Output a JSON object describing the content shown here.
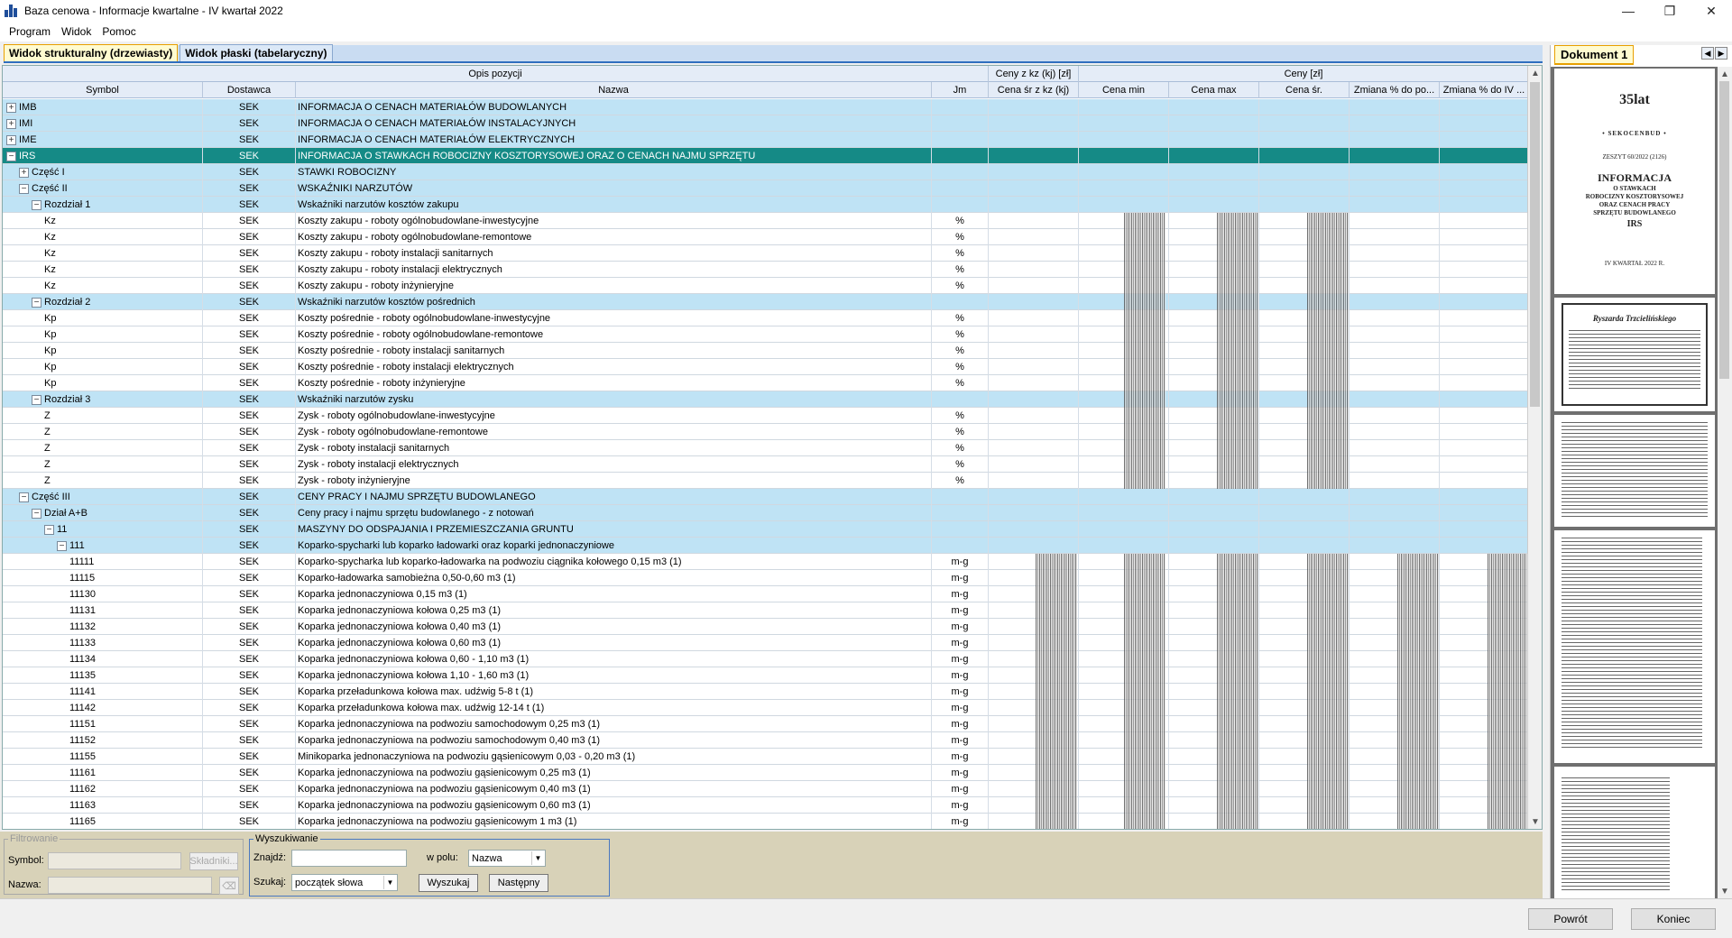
{
  "window": {
    "title": "Baza cenowa - Informacje kwartalne - IV kwartał 2022",
    "minimize": "—",
    "maximize": "❐",
    "close": "✕"
  },
  "menu": [
    "Program",
    "Widok",
    "Pomoc"
  ],
  "tabs": [
    {
      "label": "Widok strukturalny (drzewiasty)"
    },
    {
      "label": "Widok płaski (tabelaryczny)"
    }
  ],
  "grid": {
    "group_headers": {
      "opis": "Opis pozycji",
      "ceny_kz": "Ceny z kz (kj) [zł]",
      "ceny": "Ceny [zł]"
    },
    "columns": [
      "Symbol",
      "Dostawca",
      "Nazwa",
      "Jm",
      "Cena śr z kz (kj)",
      "Cena min",
      "Cena max",
      "Cena śr.",
      "Zmiana % do po...",
      "Zmiana % do IV ..."
    ],
    "rows": [
      {
        "sym": "IMB",
        "dost": "SEK",
        "nazwa": "INFORMACJA O CENACH MATERIAŁÓW BUDOWLANYCH",
        "jm": "",
        "lvl": 0,
        "exp": "+",
        "type": "grp"
      },
      {
        "sym": "IMI",
        "dost": "SEK",
        "nazwa": "INFORMACJA O CENACH MATERIAŁÓW INSTALACYJNYCH",
        "jm": "",
        "lvl": 0,
        "exp": "+",
        "type": "grp"
      },
      {
        "sym": "IME",
        "dost": "SEK",
        "nazwa": "INFORMACJA O CENACH MATERIAŁÓW ELEKTRYCZNYCH",
        "jm": "",
        "lvl": 0,
        "exp": "+",
        "type": "grp"
      },
      {
        "sym": "IRS",
        "dost": "SEK",
        "nazwa": "INFORMACJA O STAWKACH ROBOCIZNY KOSZTORYSOWEJ ORAZ O CENACH NAJMU SPRZĘTU",
        "jm": "",
        "lvl": 0,
        "exp": "−",
        "type": "sel"
      },
      {
        "sym": "Część I",
        "dost": "SEK",
        "nazwa": "STAWKI ROBOCIZNY",
        "jm": "",
        "lvl": 1,
        "exp": "+",
        "type": "grp"
      },
      {
        "sym": "Część II",
        "dost": "SEK",
        "nazwa": "WSKAŹNIKI NARZUTÓW",
        "jm": "",
        "lvl": 1,
        "exp": "−",
        "type": "grp"
      },
      {
        "sym": "Rozdział 1",
        "dost": "SEK",
        "nazwa": "Wskaźniki narzutów kosztów zakupu",
        "jm": "",
        "lvl": 2,
        "exp": "−",
        "type": "grp"
      },
      {
        "sym": "Kz",
        "dost": "SEK",
        "nazwa": "Koszty zakupu - roboty ogólnobudowlane-inwestycyjne",
        "jm": "%",
        "lvl": 3,
        "exp": "",
        "type": "leaf"
      },
      {
        "sym": "Kz",
        "dost": "SEK",
        "nazwa": "Koszty zakupu - roboty ogólnobudowlane-remontowe",
        "jm": "%",
        "lvl": 3,
        "exp": "",
        "type": "leaf"
      },
      {
        "sym": "Kz",
        "dost": "SEK",
        "nazwa": "Koszty zakupu - roboty instalacji sanitarnych",
        "jm": "%",
        "lvl": 3,
        "exp": "",
        "type": "leaf"
      },
      {
        "sym": "Kz",
        "dost": "SEK",
        "nazwa": "Koszty zakupu - roboty instalacji elektrycznych",
        "jm": "%",
        "lvl": 3,
        "exp": "",
        "type": "leaf"
      },
      {
        "sym": "Kz",
        "dost": "SEK",
        "nazwa": "Koszty zakupu - roboty inżynieryjne",
        "jm": "%",
        "lvl": 3,
        "exp": "",
        "type": "leaf"
      },
      {
        "sym": "Rozdział 2",
        "dost": "SEK",
        "nazwa": "Wskaźniki narzutów kosztów pośrednich",
        "jm": "",
        "lvl": 2,
        "exp": "−",
        "type": "grp"
      },
      {
        "sym": "Kp",
        "dost": "SEK",
        "nazwa": "Koszty pośrednie - roboty ogólnobudowlane-inwestycyjne",
        "jm": "%",
        "lvl": 3,
        "exp": "",
        "type": "leaf"
      },
      {
        "sym": "Kp",
        "dost": "SEK",
        "nazwa": "Koszty pośrednie - roboty ogólnobudowlane-remontowe",
        "jm": "%",
        "lvl": 3,
        "exp": "",
        "type": "leaf"
      },
      {
        "sym": "Kp",
        "dost": "SEK",
        "nazwa": "Koszty pośrednie - roboty instalacji sanitarnych",
        "jm": "%",
        "lvl": 3,
        "exp": "",
        "type": "leaf"
      },
      {
        "sym": "Kp",
        "dost": "SEK",
        "nazwa": "Koszty pośrednie - roboty instalacji elektrycznych",
        "jm": "%",
        "lvl": 3,
        "exp": "",
        "type": "leaf"
      },
      {
        "sym": "Kp",
        "dost": "SEK",
        "nazwa": "Koszty pośrednie - roboty inżynieryjne",
        "jm": "%",
        "lvl": 3,
        "exp": "",
        "type": "leaf"
      },
      {
        "sym": "Rozdział 3",
        "dost": "SEK",
        "nazwa": "Wskaźniki narzutów zysku",
        "jm": "",
        "lvl": 2,
        "exp": "−",
        "type": "grp"
      },
      {
        "sym": "Z",
        "dost": "SEK",
        "nazwa": "Zysk - roboty ogólnobudowlane-inwestycyjne",
        "jm": "%",
        "lvl": 3,
        "exp": "",
        "type": "leaf"
      },
      {
        "sym": "Z",
        "dost": "SEK",
        "nazwa": "Zysk - roboty ogólnobudowlane-remontowe",
        "jm": "%",
        "lvl": 3,
        "exp": "",
        "type": "leaf"
      },
      {
        "sym": "Z",
        "dost": "SEK",
        "nazwa": "Zysk - roboty instalacji sanitarnych",
        "jm": "%",
        "lvl": 3,
        "exp": "",
        "type": "leaf"
      },
      {
        "sym": "Z",
        "dost": "SEK",
        "nazwa": "Zysk - roboty instalacji elektrycznych",
        "jm": "%",
        "lvl": 3,
        "exp": "",
        "type": "leaf"
      },
      {
        "sym": "Z",
        "dost": "SEK",
        "nazwa": "Zysk - roboty inżynieryjne",
        "jm": "%",
        "lvl": 3,
        "exp": "",
        "type": "leaf"
      },
      {
        "sym": "Część III",
        "dost": "SEK",
        "nazwa": "CENY PRACY I NAJMU SPRZĘTU BUDOWLANEGO",
        "jm": "",
        "lvl": 1,
        "exp": "−",
        "type": "grp"
      },
      {
        "sym": "Dział A+B",
        "dost": "SEK",
        "nazwa": "Ceny pracy i najmu sprzętu budowlanego - z notowań",
        "jm": "",
        "lvl": 2,
        "exp": "−",
        "type": "grp"
      },
      {
        "sym": "11",
        "dost": "SEK",
        "nazwa": "MASZYNY DO ODSPAJANIA I PRZEMIESZCZANIA GRUNTU",
        "jm": "",
        "lvl": 3,
        "exp": "−",
        "type": "grp"
      },
      {
        "sym": "111",
        "dost": "SEK",
        "nazwa": "Koparko-spycharki lub koparko ładowarki oraz koparki jednonaczyniowe",
        "jm": "",
        "lvl": 4,
        "exp": "−",
        "type": "grp"
      },
      {
        "sym": "11111",
        "dost": "SEK",
        "nazwa": "Koparko-spycharka lub koparko-ładowarka na podwoziu ciągnika kołowego 0,15 m3 (1)",
        "jm": "m-g",
        "lvl": 5,
        "exp": "",
        "type": "leaf"
      },
      {
        "sym": "11115",
        "dost": "SEK",
        "nazwa": "Koparko-ładowarka samobieżna 0,50-0,60 m3 (1)",
        "jm": "m-g",
        "lvl": 5,
        "exp": "",
        "type": "leaf"
      },
      {
        "sym": "11130",
        "dost": "SEK",
        "nazwa": "Koparka jednonaczyniowa 0,15 m3 (1)",
        "jm": "m-g",
        "lvl": 5,
        "exp": "",
        "type": "leaf"
      },
      {
        "sym": "11131",
        "dost": "SEK",
        "nazwa": "Koparka jednonaczyniowa kołowa 0,25 m3 (1)",
        "jm": "m-g",
        "lvl": 5,
        "exp": "",
        "type": "leaf"
      },
      {
        "sym": "11132",
        "dost": "SEK",
        "nazwa": "Koparka jednonaczyniowa kołowa 0,40 m3 (1)",
        "jm": "m-g",
        "lvl": 5,
        "exp": "",
        "type": "leaf"
      },
      {
        "sym": "11133",
        "dost": "SEK",
        "nazwa": "Koparka jednonaczyniowa kołowa 0,60 m3 (1)",
        "jm": "m-g",
        "lvl": 5,
        "exp": "",
        "type": "leaf"
      },
      {
        "sym": "11134",
        "dost": "SEK",
        "nazwa": "Koparka jednonaczyniowa kołowa 0,60 - 1,10 m3 (1)",
        "jm": "m-g",
        "lvl": 5,
        "exp": "",
        "type": "leaf"
      },
      {
        "sym": "11135",
        "dost": "SEK",
        "nazwa": "Koparka jednonaczyniowa kołowa 1,10 - 1,60 m3 (1)",
        "jm": "m-g",
        "lvl": 5,
        "exp": "",
        "type": "leaf"
      },
      {
        "sym": "11141",
        "dost": "SEK",
        "nazwa": "Koparka przeładunkowa kołowa max. udźwig 5-8 t (1)",
        "jm": "m-g",
        "lvl": 5,
        "exp": "",
        "type": "leaf"
      },
      {
        "sym": "11142",
        "dost": "SEK",
        "nazwa": "Koparka przeładunkowa kołowa max. udźwig 12-14 t (1)",
        "jm": "m-g",
        "lvl": 5,
        "exp": "",
        "type": "leaf"
      },
      {
        "sym": "11151",
        "dost": "SEK",
        "nazwa": "Koparka jednonaczyniowa na podwoziu samochodowym 0,25 m3 (1)",
        "jm": "m-g",
        "lvl": 5,
        "exp": "",
        "type": "leaf"
      },
      {
        "sym": "11152",
        "dost": "SEK",
        "nazwa": "Koparka jednonaczyniowa na podwoziu samochodowym 0,40 m3 (1)",
        "jm": "m-g",
        "lvl": 5,
        "exp": "",
        "type": "leaf"
      },
      {
        "sym": "11155",
        "dost": "SEK",
        "nazwa": "Minikoparka jednonaczyniowa na podwoziu gąsienicowym 0,03 - 0,20 m3 (1)",
        "jm": "m-g",
        "lvl": 5,
        "exp": "",
        "type": "leaf"
      },
      {
        "sym": "11161",
        "dost": "SEK",
        "nazwa": "Koparka jednonaczyniowa na podwoziu gąsienicowym 0,25 m3 (1)",
        "jm": "m-g",
        "lvl": 5,
        "exp": "",
        "type": "leaf"
      },
      {
        "sym": "11162",
        "dost": "SEK",
        "nazwa": "Koparka jednonaczyniowa na podwoziu gąsienicowym 0,40 m3 (1)",
        "jm": "m-g",
        "lvl": 5,
        "exp": "",
        "type": "leaf"
      },
      {
        "sym": "11163",
        "dost": "SEK",
        "nazwa": "Koparka jednonaczyniowa na podwoziu gąsienicowym 0,60 m3 (1)",
        "jm": "m-g",
        "lvl": 5,
        "exp": "",
        "type": "leaf"
      },
      {
        "sym": "11165",
        "dost": "SEK",
        "nazwa": "Koparka jednonaczyniowa na podwoziu gąsienicowym 1 m3 (1)",
        "jm": "m-g",
        "lvl": 5,
        "exp": "",
        "type": "leaf"
      }
    ]
  },
  "filter": {
    "legend": "Filtrowanie",
    "symbol_label": "Symbol:",
    "skladniki_button": "Składniki...",
    "nazwa_label": "Nazwa:",
    "clear_button": "⌫"
  },
  "search": {
    "legend": "Wyszukiwanie",
    "znajdz_label": "Znajdź:",
    "w_polu_label": "w polu:",
    "w_polu_value": "Nazwa",
    "szukaj_label": "Szukaj:",
    "szukaj_value": "początek słowa",
    "find_button": "Wyszukaj",
    "next_button": "Następny"
  },
  "doc": {
    "tab": "Dokument 1",
    "nav_prev": "◀",
    "nav_next": "▶",
    "cover": {
      "logo": "35lat",
      "brand": "• SEKOCENBUD •",
      "issue": "ZESZYT 60/2022 (2126)",
      "title": "INFORMACJA",
      "sub1": "O STAWKACH",
      "sub2": "ROBOCIZNY KOSZTORYSOWEJ",
      "sub3": "ORAZ CENACH PRACY",
      "sub4": "SPRZĘTU BUDOWLANEGO",
      "code": "IRS",
      "period": "IV KWARTAŁ 2022 R."
    },
    "memorial": {
      "name": "Ryszarda Trzcielińskiego"
    }
  },
  "footer": {
    "back_button": "Powrót",
    "end_button": "Koniec"
  }
}
